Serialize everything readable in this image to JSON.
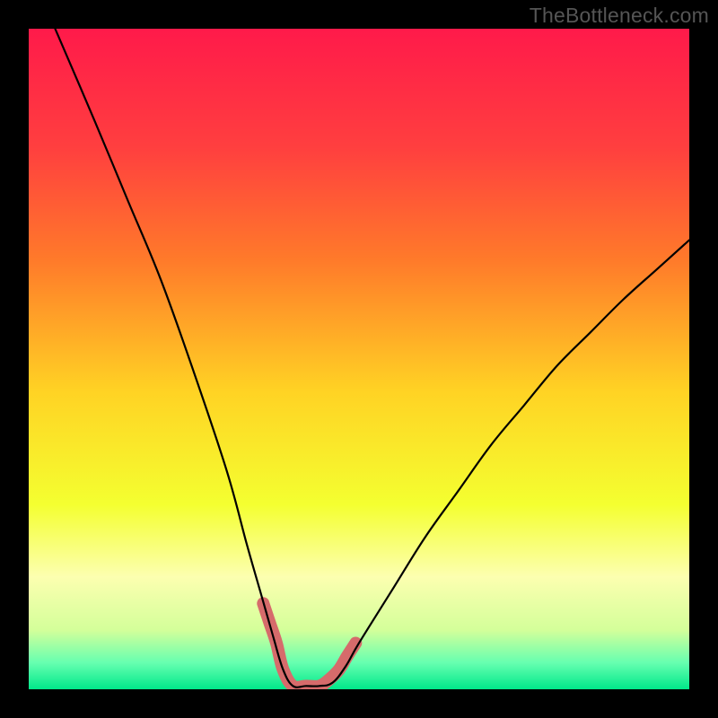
{
  "watermark": {
    "text": "TheBottleneck.com"
  },
  "chart_data": {
    "type": "line",
    "title": "",
    "xlabel": "",
    "ylabel": "",
    "xlim": [
      0,
      100
    ],
    "ylim": [
      0,
      100
    ],
    "grid": false,
    "legend": false,
    "annotations": [],
    "series": [
      {
        "name": "bottleneck-curve",
        "color": "#000000",
        "x": [
          4,
          10,
          15,
          20,
          25,
          30,
          33,
          35,
          37,
          38.5,
          40,
          42,
          44,
          46,
          48,
          50,
          55,
          60,
          65,
          70,
          75,
          80,
          85,
          90,
          95,
          100
        ],
        "y": [
          100,
          86,
          74,
          62,
          48,
          33,
          22,
          15,
          8,
          3,
          0.5,
          0.5,
          0.5,
          1,
          3.5,
          7,
          15,
          23,
          30,
          37,
          43,
          49,
          54,
          59,
          63.5,
          68
        ]
      },
      {
        "name": "optimal-highlight",
        "color": "#d66b6b",
        "x": [
          35.5,
          36.5,
          37.5,
          38.5,
          40,
          42,
          44,
          45.5,
          47,
          48.2,
          49.5
        ],
        "y": [
          13,
          10,
          7,
          3,
          0.5,
          0.5,
          0.5,
          1.5,
          3,
          5,
          7
        ]
      }
    ],
    "background_gradient": {
      "type": "vertical",
      "stops": [
        {
          "offset": 0.0,
          "color": "#ff1a4a"
        },
        {
          "offset": 0.18,
          "color": "#ff3f3f"
        },
        {
          "offset": 0.35,
          "color": "#ff7a2a"
        },
        {
          "offset": 0.55,
          "color": "#ffd324"
        },
        {
          "offset": 0.72,
          "color": "#f4ff30"
        },
        {
          "offset": 0.83,
          "color": "#fcffb0"
        },
        {
          "offset": 0.91,
          "color": "#d4ff9a"
        },
        {
          "offset": 0.96,
          "color": "#66ffb0"
        },
        {
          "offset": 1.0,
          "color": "#00e88a"
        }
      ]
    },
    "highlight_style": {
      "stroke_width_px": 14,
      "linecap": "round"
    }
  }
}
